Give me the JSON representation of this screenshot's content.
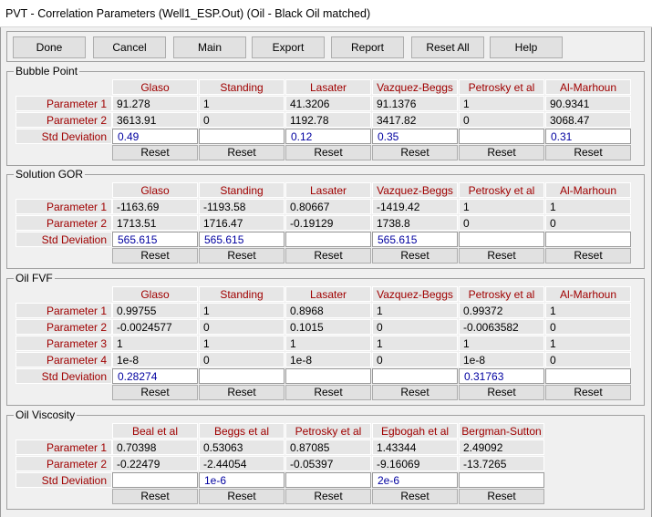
{
  "window": {
    "title": "PVT - Correlation Parameters (Well1_ESP.Out)  (Oil - Black Oil matched)"
  },
  "toolbar": {
    "buttons": [
      "Done",
      "Cancel",
      "Main",
      "Export",
      "Report",
      "Reset All",
      "Help"
    ]
  },
  "reset_label": "Reset",
  "sections": [
    {
      "title": "Bubble Point",
      "columns": [
        "Glaso",
        "Standing",
        "Lasater",
        "Vazquez-Beggs",
        "Petrosky et al",
        "Al-Marhoun"
      ],
      "params": [
        {
          "label": "Parameter 1",
          "values": [
            "91.278",
            "1",
            "41.3206",
            "91.1376",
            "1",
            "90.9341"
          ]
        },
        {
          "label": "Parameter 2",
          "values": [
            "3613.91",
            "0",
            "1192.78",
            "3417.82",
            "0",
            "3068.47"
          ]
        }
      ],
      "std": {
        "label": "Std Deviation",
        "values": [
          "0.49",
          "",
          "0.12",
          "0.35",
          "",
          "0.31"
        ]
      }
    },
    {
      "title": "Solution GOR",
      "columns": [
        "Glaso",
        "Standing",
        "Lasater",
        "Vazquez-Beggs",
        "Petrosky et al",
        "Al-Marhoun"
      ],
      "params": [
        {
          "label": "Parameter 1",
          "values": [
            "-1163.69",
            "-1193.58",
            "0.80667",
            "-1419.42",
            "1",
            "1"
          ]
        },
        {
          "label": "Parameter 2",
          "values": [
            "1713.51",
            "1716.47",
            "-0.19129",
            "1738.8",
            "0",
            "0"
          ]
        }
      ],
      "std": {
        "label": "Std Deviation",
        "values": [
          "565.615",
          "565.615",
          "",
          "565.615",
          "",
          ""
        ]
      }
    },
    {
      "title": "Oil FVF",
      "columns": [
        "Glaso",
        "Standing",
        "Lasater",
        "Vazquez-Beggs",
        "Petrosky et al",
        "Al-Marhoun"
      ],
      "params": [
        {
          "label": "Parameter 1",
          "values": [
            "0.99755",
            "1",
            "0.8968",
            "1",
            "0.99372",
            "1"
          ]
        },
        {
          "label": "Parameter 2",
          "values": [
            "-0.0024577",
            "0",
            "0.1015",
            "0",
            "-0.0063582",
            "0"
          ]
        },
        {
          "label": "Parameter 3",
          "values": [
            "1",
            "1",
            "1",
            "1",
            "1",
            "1"
          ]
        },
        {
          "label": "Parameter 4",
          "values": [
            "1e-8",
            "0",
            "1e-8",
            "0",
            "1e-8",
            "0"
          ]
        }
      ],
      "std": {
        "label": "Std Deviation",
        "values": [
          "0.28274",
          "",
          "",
          "",
          "0.31763",
          ""
        ]
      }
    },
    {
      "title": "Oil Viscosity",
      "columns": [
        "Beal et al",
        "Beggs et al",
        "Petrosky et al",
        "Egbogah et al",
        "Bergman-Sutton"
      ],
      "params": [
        {
          "label": "Parameter 1",
          "values": [
            "0.70398",
            "0.53063",
            "0.87085",
            "1.43344",
            "2.49092"
          ]
        },
        {
          "label": "Parameter 2",
          "values": [
            "-0.22479",
            "-2.44054",
            "-0.05397",
            "-9.16069",
            "-13.7265"
          ]
        }
      ],
      "std": {
        "label": "Std Deviation",
        "values": [
          "",
          "1e-6",
          "",
          "2e-6",
          ""
        ]
      }
    }
  ]
}
